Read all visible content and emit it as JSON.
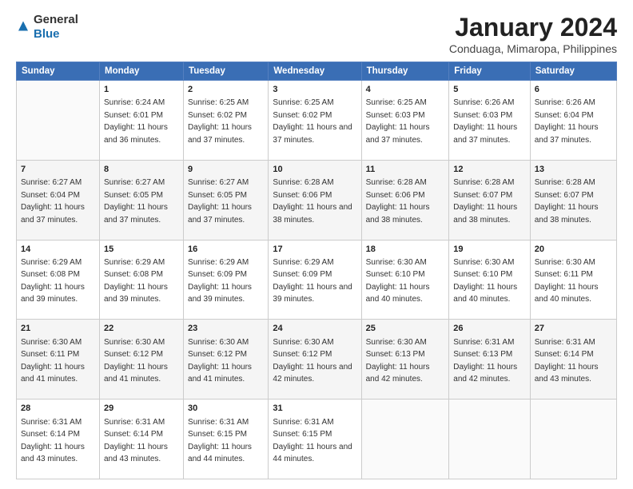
{
  "logo": {
    "general": "General",
    "blue": "Blue"
  },
  "title": "January 2024",
  "subtitle": "Conduaga, Mimaropa, Philippines",
  "headers": [
    "Sunday",
    "Monday",
    "Tuesday",
    "Wednesday",
    "Thursday",
    "Friday",
    "Saturday"
  ],
  "weeks": [
    [
      {
        "day": "",
        "sunrise": "",
        "sunset": "",
        "daylight": ""
      },
      {
        "day": "1",
        "sunrise": "Sunrise: 6:24 AM",
        "sunset": "Sunset: 6:01 PM",
        "daylight": "Daylight: 11 hours and 36 minutes."
      },
      {
        "day": "2",
        "sunrise": "Sunrise: 6:25 AM",
        "sunset": "Sunset: 6:02 PM",
        "daylight": "Daylight: 11 hours and 37 minutes."
      },
      {
        "day": "3",
        "sunrise": "Sunrise: 6:25 AM",
        "sunset": "Sunset: 6:02 PM",
        "daylight": "Daylight: 11 hours and 37 minutes."
      },
      {
        "day": "4",
        "sunrise": "Sunrise: 6:25 AM",
        "sunset": "Sunset: 6:03 PM",
        "daylight": "Daylight: 11 hours and 37 minutes."
      },
      {
        "day": "5",
        "sunrise": "Sunrise: 6:26 AM",
        "sunset": "Sunset: 6:03 PM",
        "daylight": "Daylight: 11 hours and 37 minutes."
      },
      {
        "day": "6",
        "sunrise": "Sunrise: 6:26 AM",
        "sunset": "Sunset: 6:04 PM",
        "daylight": "Daylight: 11 hours and 37 minutes."
      }
    ],
    [
      {
        "day": "7",
        "sunrise": "Sunrise: 6:27 AM",
        "sunset": "Sunset: 6:04 PM",
        "daylight": "Daylight: 11 hours and 37 minutes."
      },
      {
        "day": "8",
        "sunrise": "Sunrise: 6:27 AM",
        "sunset": "Sunset: 6:05 PM",
        "daylight": "Daylight: 11 hours and 37 minutes."
      },
      {
        "day": "9",
        "sunrise": "Sunrise: 6:27 AM",
        "sunset": "Sunset: 6:05 PM",
        "daylight": "Daylight: 11 hours and 37 minutes."
      },
      {
        "day": "10",
        "sunrise": "Sunrise: 6:28 AM",
        "sunset": "Sunset: 6:06 PM",
        "daylight": "Daylight: 11 hours and 38 minutes."
      },
      {
        "day": "11",
        "sunrise": "Sunrise: 6:28 AM",
        "sunset": "Sunset: 6:06 PM",
        "daylight": "Daylight: 11 hours and 38 minutes."
      },
      {
        "day": "12",
        "sunrise": "Sunrise: 6:28 AM",
        "sunset": "Sunset: 6:07 PM",
        "daylight": "Daylight: 11 hours and 38 minutes."
      },
      {
        "day": "13",
        "sunrise": "Sunrise: 6:28 AM",
        "sunset": "Sunset: 6:07 PM",
        "daylight": "Daylight: 11 hours and 38 minutes."
      }
    ],
    [
      {
        "day": "14",
        "sunrise": "Sunrise: 6:29 AM",
        "sunset": "Sunset: 6:08 PM",
        "daylight": "Daylight: 11 hours and 39 minutes."
      },
      {
        "day": "15",
        "sunrise": "Sunrise: 6:29 AM",
        "sunset": "Sunset: 6:08 PM",
        "daylight": "Daylight: 11 hours and 39 minutes."
      },
      {
        "day": "16",
        "sunrise": "Sunrise: 6:29 AM",
        "sunset": "Sunset: 6:09 PM",
        "daylight": "Daylight: 11 hours and 39 minutes."
      },
      {
        "day": "17",
        "sunrise": "Sunrise: 6:29 AM",
        "sunset": "Sunset: 6:09 PM",
        "daylight": "Daylight: 11 hours and 39 minutes."
      },
      {
        "day": "18",
        "sunrise": "Sunrise: 6:30 AM",
        "sunset": "Sunset: 6:10 PM",
        "daylight": "Daylight: 11 hours and 40 minutes."
      },
      {
        "day": "19",
        "sunrise": "Sunrise: 6:30 AM",
        "sunset": "Sunset: 6:10 PM",
        "daylight": "Daylight: 11 hours and 40 minutes."
      },
      {
        "day": "20",
        "sunrise": "Sunrise: 6:30 AM",
        "sunset": "Sunset: 6:11 PM",
        "daylight": "Daylight: 11 hours and 40 minutes."
      }
    ],
    [
      {
        "day": "21",
        "sunrise": "Sunrise: 6:30 AM",
        "sunset": "Sunset: 6:11 PM",
        "daylight": "Daylight: 11 hours and 41 minutes."
      },
      {
        "day": "22",
        "sunrise": "Sunrise: 6:30 AM",
        "sunset": "Sunset: 6:12 PM",
        "daylight": "Daylight: 11 hours and 41 minutes."
      },
      {
        "day": "23",
        "sunrise": "Sunrise: 6:30 AM",
        "sunset": "Sunset: 6:12 PM",
        "daylight": "Daylight: 11 hours and 41 minutes."
      },
      {
        "day": "24",
        "sunrise": "Sunrise: 6:30 AM",
        "sunset": "Sunset: 6:12 PM",
        "daylight": "Daylight: 11 hours and 42 minutes."
      },
      {
        "day": "25",
        "sunrise": "Sunrise: 6:30 AM",
        "sunset": "Sunset: 6:13 PM",
        "daylight": "Daylight: 11 hours and 42 minutes."
      },
      {
        "day": "26",
        "sunrise": "Sunrise: 6:31 AM",
        "sunset": "Sunset: 6:13 PM",
        "daylight": "Daylight: 11 hours and 42 minutes."
      },
      {
        "day": "27",
        "sunrise": "Sunrise: 6:31 AM",
        "sunset": "Sunset: 6:14 PM",
        "daylight": "Daylight: 11 hours and 43 minutes."
      }
    ],
    [
      {
        "day": "28",
        "sunrise": "Sunrise: 6:31 AM",
        "sunset": "Sunset: 6:14 PM",
        "daylight": "Daylight: 11 hours and 43 minutes."
      },
      {
        "day": "29",
        "sunrise": "Sunrise: 6:31 AM",
        "sunset": "Sunset: 6:14 PM",
        "daylight": "Daylight: 11 hours and 43 minutes."
      },
      {
        "day": "30",
        "sunrise": "Sunrise: 6:31 AM",
        "sunset": "Sunset: 6:15 PM",
        "daylight": "Daylight: 11 hours and 44 minutes."
      },
      {
        "day": "31",
        "sunrise": "Sunrise: 6:31 AM",
        "sunset": "Sunset: 6:15 PM",
        "daylight": "Daylight: 11 hours and 44 minutes."
      },
      {
        "day": "",
        "sunrise": "",
        "sunset": "",
        "daylight": ""
      },
      {
        "day": "",
        "sunrise": "",
        "sunset": "",
        "daylight": ""
      },
      {
        "day": "",
        "sunrise": "",
        "sunset": "",
        "daylight": ""
      }
    ]
  ]
}
